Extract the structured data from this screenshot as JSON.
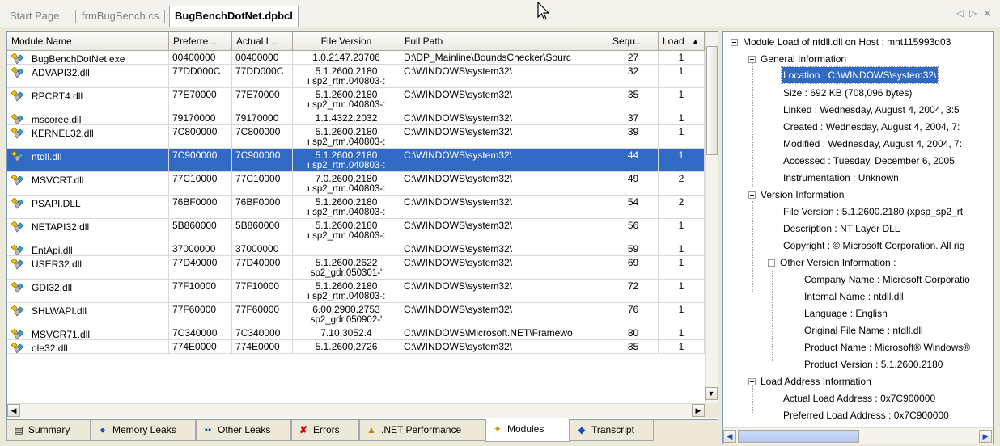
{
  "doc_tabs": {
    "start_page": "Start Page",
    "form_file": "frmBugBench.cs",
    "active_file": "BugBenchDotNet.dpbcl"
  },
  "grid": {
    "columns": [
      "Module Name",
      "Preferre...",
      "Actual L...",
      "File Version",
      "Full Path",
      "Sequ...",
      "Load"
    ],
    "rows": [
      {
        "name": "BugBenchDotNet.exe",
        "preferred": "00400000",
        "actual": "00400000",
        "version": "1.0.2147.23706",
        "version2": "",
        "path": "D:\\DP_Mainline\\BoundsChecker\\Sourc",
        "seq": "27",
        "load": "1"
      },
      {
        "name": "ADVAPI32.dll",
        "preferred": "77DD000C",
        "actual": "77DD000C",
        "version": "5.1.2600.2180",
        "version2": "ı sp2_rtm.040803-:",
        "path": "C:\\WINDOWS\\system32\\",
        "seq": "32",
        "load": "1"
      },
      {
        "name": "RPCRT4.dll",
        "preferred": "77E70000",
        "actual": "77E70000",
        "version": "5.1.2600.2180",
        "version2": "ı sp2_rtm.040803-:",
        "path": "C:\\WINDOWS\\system32\\",
        "seq": "35",
        "load": "1"
      },
      {
        "name": "mscoree.dll",
        "preferred": "79170000",
        "actual": "79170000",
        "version": "1.1.4322.2032",
        "version2": "",
        "path": "C:\\WINDOWS\\system32\\",
        "seq": "37",
        "load": "1"
      },
      {
        "name": "KERNEL32.dll",
        "preferred": "7C800000",
        "actual": "7C800000",
        "version": "5.1.2600.2180",
        "version2": "ı sp2_rtm.040803-:",
        "path": "C:\\WINDOWS\\system32\\",
        "seq": "39",
        "load": "1"
      },
      {
        "name": "ntdll.dll",
        "preferred": "7C900000",
        "actual": "7C900000",
        "version": "5.1.2600.2180",
        "version2": "ı sp2_rtm.040803-:",
        "path": "C:\\WINDOWS\\system32\\",
        "seq": "44",
        "load": "1"
      },
      {
        "name": "MSVCRT.dll",
        "preferred": "77C10000",
        "actual": "77C10000",
        "version": "7.0.2600.2180",
        "version2": "ı sp2_rtm.040803-:",
        "path": "C:\\WINDOWS\\system32\\",
        "seq": "49",
        "load": "2"
      },
      {
        "name": "PSAPI.DLL",
        "preferred": "76BF0000",
        "actual": "76BF0000",
        "version": "5.1.2600.2180",
        "version2": "ı sp2_rtm.040803-:",
        "path": "C:\\WINDOWS\\system32\\",
        "seq": "54",
        "load": "2"
      },
      {
        "name": "NETAPI32.dll",
        "preferred": "5B860000",
        "actual": "5B860000",
        "version": "5.1.2600.2180",
        "version2": "ı sp2_rtm.040803-:",
        "path": "C:\\WINDOWS\\system32\\",
        "seq": "56",
        "load": "1"
      },
      {
        "name": "EntApi.dll",
        "preferred": "37000000",
        "actual": "37000000",
        "version": "",
        "version2": "",
        "path": "C:\\WINDOWS\\system32\\",
        "seq": "59",
        "load": "1"
      },
      {
        "name": "USER32.dll",
        "preferred": "77D40000",
        "actual": "77D40000",
        "version": "5.1.2600.2622",
        "version2": "sp2_gdr.050301-'",
        "path": "C:\\WINDOWS\\system32\\",
        "seq": "69",
        "load": "1"
      },
      {
        "name": "GDI32.dll",
        "preferred": "77F10000",
        "actual": "77F10000",
        "version": "5.1.2600.2180",
        "version2": "ı sp2_rtm.040803-:",
        "path": "C:\\WINDOWS\\system32\\",
        "seq": "72",
        "load": "1"
      },
      {
        "name": "SHLWAPI.dll",
        "preferred": "77F60000",
        "actual": "77F60000",
        "version": "6.00.2900.2753",
        "version2": "sp2_gdr.050902-'",
        "path": "C:\\WINDOWS\\system32\\",
        "seq": "76",
        "load": "1"
      },
      {
        "name": "MSVCR71.dll",
        "preferred": "7C340000",
        "actual": "7C340000",
        "version": "7.10.3052.4",
        "version2": "",
        "path": "C:\\WINDOWS\\Microsoft.NET\\Framewo",
        "seq": "80",
        "load": "1"
      },
      {
        "name": "ole32.dll",
        "preferred": "774E0000",
        "actual": "774E0000",
        "version": "5.1.2600.2726",
        "version2": "",
        "path": "C:\\WINDOWS\\system32\\",
        "seq": "85",
        "load": "1"
      }
    ],
    "selected_row": 5
  },
  "bottom_tabs": [
    {
      "label": "Summary",
      "icon": "summary-icon"
    },
    {
      "label": "Memory Leaks",
      "icon": "memory-leak-icon"
    },
    {
      "label": "Other Leaks",
      "icon": "other-leaks-icon"
    },
    {
      "label": "Errors",
      "icon": "errors-icon"
    },
    {
      "label": ".NET Performance",
      "icon": "net-performance-icon"
    },
    {
      "label": "Modules",
      "icon": "modules-icon",
      "active": true
    },
    {
      "label": "Transcript",
      "icon": "transcript-icon"
    }
  ],
  "tree": {
    "root": "Module Load of ntdll.dll on Host : mht115993d03",
    "general": "General Information",
    "location": "Location : C:\\WINDOWS\\system32\\",
    "size": "Size : 692 KB (708,096 bytes)",
    "linked": "Linked : Wednesday, August 4, 2004, 3:5",
    "created": "Created : Wednesday, August 4, 2004, 7:",
    "modified": "Modified : Wednesday, August 4, 2004, 7:",
    "accessed": "Accessed : Tuesday, December 6, 2005,",
    "instrumentation": "Instrumentation : Unknown",
    "version_info": "Version Information",
    "file_version": "File Version : 5.1.2600.2180 (xpsp_sp2_rt",
    "description": "Description : NT Layer DLL",
    "copyright": "Copyright : © Microsoft Corporation. All rig",
    "other_version": "Other Version Information :",
    "company": "Company Name : Microsoft Corporatio",
    "internal": "Internal Name : ntdll.dll",
    "language": "Language : English",
    "original": "Original File Name : ntdll.dll",
    "product": "Product Name : Microsoft® Windows®",
    "product_version": "Product Version : 5.1.2600.2180",
    "load_address": "Load Address Information",
    "actual_load": "Actual Load Address : 0x7C900000",
    "preferred_load": "Preferred Load Address : 0x7C900000"
  },
  "colors": {
    "selection": "#316ac5",
    "chrome": "#ece9d8",
    "border": "#7f9db9"
  }
}
